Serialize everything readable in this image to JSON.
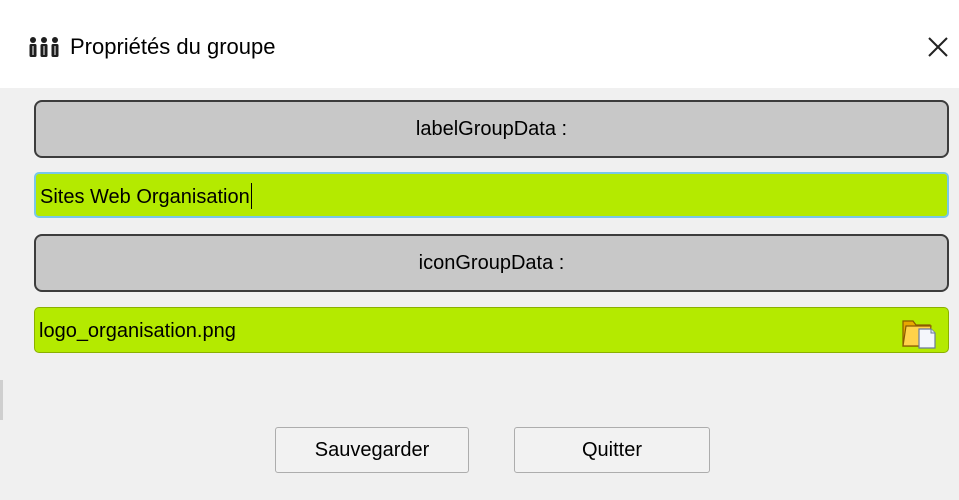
{
  "window": {
    "title": "Propriétés du groupe",
    "title_icon": "group-people-icon",
    "close_icon": "close-icon"
  },
  "form": {
    "label_group_data": "labelGroupData :",
    "group_name_value": "Sites Web Organisation",
    "icon_group_data": "iconGroupData :",
    "icon_file_value": "logo_organisation.png",
    "browse_icon": "folder-browse-icon"
  },
  "buttons": {
    "save_label": "Sauvegarder",
    "quit_label": "Quitter"
  },
  "colors": {
    "field_green": "#b4ea00",
    "label_gray": "#c8c8c8",
    "focus_border": "#78c8e8"
  }
}
